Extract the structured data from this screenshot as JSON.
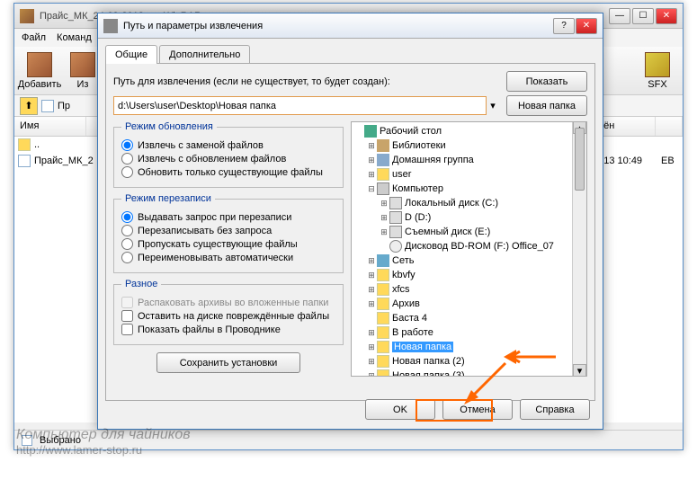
{
  "main_window": {
    "title": "Прайс_МК_24-09-2013 - ... WinRAR",
    "menu": [
      "Файл",
      "Команд"
    ],
    "toolbar": {
      "add": "Добавить",
      "extract": "Из",
      "sfx": "SFX"
    },
    "path": "Пр",
    "columns": {
      "name": "Имя",
      "modified": "нён"
    },
    "rows": {
      "up": "..",
      "file": "Прайс_МК_2",
      "date": "2013 10:49",
      "eb": "EB"
    },
    "status": "Выбрано"
  },
  "dialog": {
    "title": "Путь и параметры извлечения",
    "tabs": {
      "general": "Общие",
      "advanced": "Дополнительно"
    },
    "path_label": "Путь для извлечения (если не существует, то будет создан):",
    "path_value": "d:\\Users\\user\\Desktop\\Новая папка",
    "show_btn": "Показать",
    "newfolder_btn": "Новая папка",
    "update_mode": {
      "legend": "Режим обновления",
      "o1": "Извлечь с заменой файлов",
      "o2": "Извлечь с обновлением файлов",
      "o3": "Обновить только существующие файлы"
    },
    "overwrite": {
      "legend": "Режим перезаписи",
      "o1": "Выдавать запрос при перезаписи",
      "o2": "Перезаписывать без запроса",
      "o3": "Пропускать существующие файлы",
      "o4": "Переименовывать автоматически"
    },
    "misc": {
      "legend": "Разное",
      "c1": "Распаковать архивы во вложенные папки",
      "c2": "Оставить на диске повреждённые файлы",
      "c3": "Показать файлы в Проводнике"
    },
    "save_settings": "Сохранить установки",
    "tree": {
      "desktop": "Рабочий стол",
      "libs": "Библиотеки",
      "homegroup": "Домашняя группа",
      "user": "user",
      "computer": "Компьютер",
      "disk_c": "Локальный диск (C:)",
      "disk_d": "D (D:)",
      "disk_e": "Съемный диск (E:)",
      "bd": "Дисковод BD-ROM (F:) Office_07",
      "net": "Сеть",
      "kbvfy": "kbvfy",
      "xfcs": "xfcs",
      "archive": "Архив",
      "basta": "Баста 4",
      "work": "В работе",
      "newf": "Новая папка",
      "newf2": "Новая папка (2)",
      "newf3": "Новая папка (3)"
    },
    "ok": "OK",
    "cancel": "Отмена",
    "help": "Справка"
  },
  "watermark": {
    "line1": "Компьютер для чайников",
    "line2": "http://www.lamer-stop.ru"
  }
}
